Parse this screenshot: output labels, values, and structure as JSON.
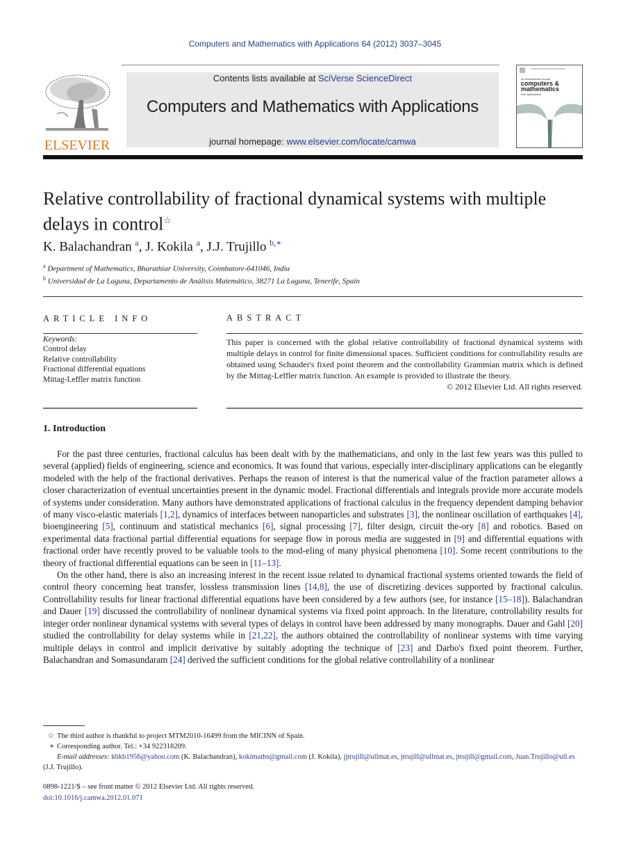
{
  "journal_citation": "Computers and Mathematics with Applications 64 (2012) 3037–3045",
  "publisher": {
    "logo_wordmark": "ELSEVIER",
    "brand_color": "#e87722"
  },
  "masthead": {
    "contents_prefix": "Contents lists available at ",
    "contents_link": "SciVerse ScienceDirect",
    "journal_title": "Computers and Mathematics with Applications",
    "homepage_prefix": "journal homepage: ",
    "homepage_link": "www.elsevier.com/locate/camwa"
  },
  "cover": {
    "line1": "An International Journal",
    "line2": "computers &",
    "line3": "mathematics",
    "line4": "with applications"
  },
  "article": {
    "title_line1": "Relative controllability of fractional dynamical systems with multiple",
    "title_line2": "delays in control",
    "title_mark": "☆",
    "authors": [
      {
        "name": "K. Balachandran",
        "sup": "a"
      },
      {
        "name": "J. Kokila",
        "sup": "a"
      },
      {
        "name": "J.J. Trujillo",
        "sup": "b,∗"
      }
    ],
    "affiliations": [
      {
        "mark": "a",
        "text": "Department of Mathematics, Bharathiar University, Coimbatore-641046, India"
      },
      {
        "mark": "b",
        "text": "Universidad de La Laguna, Departamento de Análisis Matemático, 38271 La Laguna, Tenerife, Spain"
      }
    ]
  },
  "article_info": {
    "heading": "ARTICLE INFO",
    "keywords_label": "Keywords:",
    "keywords": [
      "Control delay",
      "Relative controllability",
      "Fractional differential equations",
      "Mittag-Leffler matrix function"
    ]
  },
  "abstract": {
    "heading": "ABSTRACT",
    "text": "This paper is concerned with the global relative controllability of fractional dynamical systems with multiple delays in control for finite dimensional spaces. Sufficient conditions for controllability results are obtained using Schauder's fixed point theorem and the controllability Grammian matrix which is defined by the Mittag-Leffler matrix function. An example is provided to illustrate the theory.",
    "copyright": "© 2012 Elsevier Ltd. All rights reserved."
  },
  "introduction": {
    "heading": "1.  Introduction",
    "paragraphs": [
      [
        {
          "t": "For the past three centuries, fractional calculus has been dealt with by the mathematicians, and only in the last few years was this pulled to several (applied) fields of engineering, science and economics. It was found that various, especially inter-disciplinary applications can be elegantly modeled with the help of the fractional derivatives. Perhaps the reason of interest is that the numerical value of the fraction parameter allows a closer characterization of eventual uncertainties present in the dynamic model. Fractional differentials and integrals provide more accurate models of systems under consideration. Many authors have demonstrated applications of fractional calculus in the frequency dependent damping behavior of many visco-elastic materials "
        },
        {
          "c": "[1,2]"
        },
        {
          "t": ", dynamics of interfaces between nanoparticles and substrates "
        },
        {
          "c": "[3]"
        },
        {
          "t": ", the nonlinear oscillation of earthquakes "
        },
        {
          "c": "[4]"
        },
        {
          "t": ", bioengineering "
        },
        {
          "c": "[5]"
        },
        {
          "t": ", continuum and statistical mechanics "
        },
        {
          "c": "[6]"
        },
        {
          "t": ", signal processing "
        },
        {
          "c": "[7]"
        },
        {
          "t": ", filter design, circuit the-ory "
        },
        {
          "c": "[8]"
        },
        {
          "t": " and robotics. Based on experimental data fractional partial differential equations for seepage flow in porous media are suggested in "
        },
        {
          "c": "[9]"
        },
        {
          "t": " and differential equations with fractional order have recently proved to be valuable tools to the mod-eling of many physical phenomena "
        },
        {
          "c": "[10]"
        },
        {
          "t": ". Some recent contributions to the theory of fractional differential equations can be seen in "
        },
        {
          "c": "[11–13]"
        },
        {
          "t": "."
        }
      ],
      [
        {
          "t": "On the other hand, there is also an increasing interest in the recent issue related to dynamical fractional systems oriented towards the field of control theory concerning heat transfer, lossless transmission lines "
        },
        {
          "c": "[14,8]"
        },
        {
          "t": ", the use of discretizing devices supported by fractional calculus. Controllability results for linear fractional differential equations have been considered by a few authors (see, for instance "
        },
        {
          "c": "[15–18]"
        },
        {
          "t": "). Balachandran and Dauer "
        },
        {
          "c": "[19]"
        },
        {
          "t": " discussed the controllability of nonlinear dynamical systems via fixed point approach. In the literature, controllability results for integer order nonlinear dynamical systems with several types of delays in control have been addressed by many monographs. Dauer and Gahl "
        },
        {
          "c": "[20]"
        },
        {
          "t": " studied the controllability for delay systems while in "
        },
        {
          "c": "[21,22]"
        },
        {
          "t": ", the authors obtained the controllability of nonlinear systems with time varying multiple delays in control and implicit derivative by suitably adopting the technique of "
        },
        {
          "c": "[23]"
        },
        {
          "t": " and Darbo's fixed point theorem. Further, Balachandran and Somasundaram "
        },
        {
          "c": "[24]"
        },
        {
          "t": " derived the sufficient conditions for the global relative controllability of a nonlinear"
        }
      ]
    ]
  },
  "footnotes": {
    "star_mark": "☆",
    "star_text": "The third author is thankful to project MTM2010-16499 from the MICINN of Spain.",
    "corr_mark": "∗",
    "corr_text": "Corresponding author. Tel.: +34 922318209.",
    "email_label": "E-mail addresses:",
    "emails": [
      {
        "addr": "kbkb1956@yahoo.com",
        "who": " (K. Balachandran), "
      },
      {
        "addr": "kokimaths@gmail.com",
        "who": " (J. Kokila), "
      },
      {
        "addr": "jjtrujill@ullmat.es",
        "who": ", "
      },
      {
        "addr": "jtrujill@ullmat.es",
        "who": ", "
      },
      {
        "addr": "jtrujill@gmail.com",
        "who": ", "
      },
      {
        "addr": "Juan.Trujillo@ull.es",
        "who": " (J.J. Trujillo)."
      }
    ]
  },
  "front_matter": {
    "issn_line": "0898-1221/$ – see front matter © 2012 Elsevier Ltd. All rights reserved.",
    "doi": "doi:10.1016/j.camwa.2012.01.071"
  }
}
